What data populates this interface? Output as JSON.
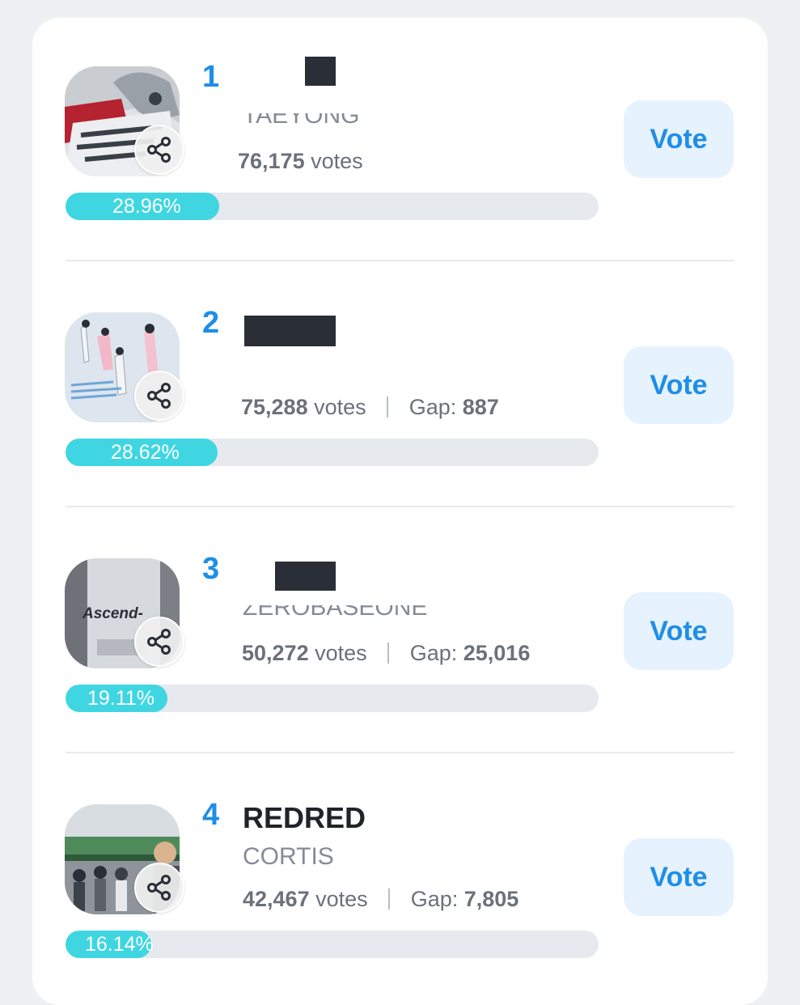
{
  "ui": {
    "vote_label": "Vote",
    "votes_suffix": "votes",
    "gap_label": "Gap:",
    "share_icon": "share-icon",
    "bar_color": "#3fd6e2",
    "accent_color": "#1e8ee8"
  },
  "entries": [
    {
      "rank": "1",
      "song": "",
      "artist": "TAEYONG",
      "votes": "76,175",
      "gap": "",
      "percent": "28.96%",
      "share": 0.2896
    },
    {
      "rank": "2",
      "song": "",
      "artist": "",
      "votes": "75,288",
      "gap": "887",
      "percent": "28.62%",
      "share": 0.2862
    },
    {
      "rank": "3",
      "song": "",
      "artist": "ZEROBASEONE",
      "votes": "50,272",
      "gap": "25,016",
      "percent": "19.11%",
      "share": 0.1911
    },
    {
      "rank": "4",
      "song": "REDRED",
      "artist": "CORTIS",
      "votes": "42,467",
      "gap": "7,805",
      "percent": "16.14%",
      "share": 0.1614
    }
  ]
}
